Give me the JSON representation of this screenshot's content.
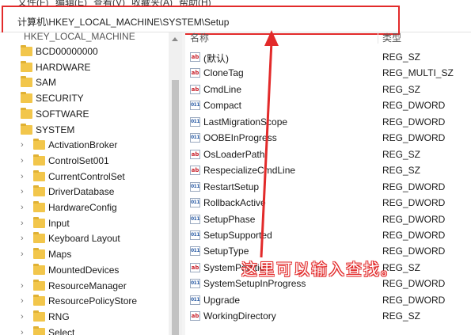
{
  "menu": {
    "items": [
      "文件(F)",
      "编辑(E)",
      "查看(V)",
      "收藏夹(A)",
      "帮助(H)"
    ]
  },
  "address": {
    "path": "计算机\\HKEY_LOCAL_MACHINE\\SYSTEM\\Setup"
  },
  "tree": {
    "root": "HKEY_LOCAL_MACHINE",
    "items": [
      {
        "label": "BCD00000000",
        "level": 1,
        "expandable": false
      },
      {
        "label": "HARDWARE",
        "level": 1,
        "expandable": false
      },
      {
        "label": "SAM",
        "level": 1,
        "expandable": false
      },
      {
        "label": "SECURITY",
        "level": 1,
        "expandable": false
      },
      {
        "label": "SOFTWARE",
        "level": 1,
        "expandable": false
      },
      {
        "label": "SYSTEM",
        "level": 1,
        "expandable": false
      },
      {
        "label": "ActivationBroker",
        "level": 2,
        "expandable": true
      },
      {
        "label": "ControlSet001",
        "level": 2,
        "expandable": true
      },
      {
        "label": "CurrentControlSet",
        "level": 2,
        "expandable": true
      },
      {
        "label": "DriverDatabase",
        "level": 2,
        "expandable": true
      },
      {
        "label": "HardwareConfig",
        "level": 2,
        "expandable": true
      },
      {
        "label": "Input",
        "level": 2,
        "expandable": true
      },
      {
        "label": "Keyboard Layout",
        "level": 2,
        "expandable": true
      },
      {
        "label": "Maps",
        "level": 2,
        "expandable": true
      },
      {
        "label": "MountedDevices",
        "level": 2,
        "expandable": false
      },
      {
        "label": "ResourceManager",
        "level": 2,
        "expandable": true
      },
      {
        "label": "ResourcePolicyStore",
        "level": 2,
        "expandable": true
      },
      {
        "label": "RNG",
        "level": 2,
        "expandable": true
      },
      {
        "label": "Select",
        "level": 2,
        "expandable": true
      }
    ]
  },
  "list": {
    "headers": {
      "name": "名称",
      "type": "类型"
    },
    "values": [
      {
        "name": "(默认)",
        "type": "REG_SZ",
        "icon": "ab"
      },
      {
        "name": "CloneTag",
        "type": "REG_MULTI_SZ",
        "icon": "ab"
      },
      {
        "name": "CmdLine",
        "type": "REG_SZ",
        "icon": "ab"
      },
      {
        "name": "Compact",
        "type": "REG_DWORD",
        "icon": "bin"
      },
      {
        "name": "LastMigrationScope",
        "type": "REG_DWORD",
        "icon": "bin"
      },
      {
        "name": "OOBEInProgress",
        "type": "REG_DWORD",
        "icon": "bin"
      },
      {
        "name": "OsLoaderPath",
        "type": "REG_SZ",
        "icon": "ab"
      },
      {
        "name": "RespecializeCmdLine",
        "type": "REG_SZ",
        "icon": "ab"
      },
      {
        "name": "RestartSetup",
        "type": "REG_DWORD",
        "icon": "bin"
      },
      {
        "name": "RollbackActive",
        "type": "REG_DWORD",
        "icon": "bin"
      },
      {
        "name": "SetupPhase",
        "type": "REG_DWORD",
        "icon": "bin"
      },
      {
        "name": "SetupSupported",
        "type": "REG_DWORD",
        "icon": "bin"
      },
      {
        "name": "SetupType",
        "type": "REG_DWORD",
        "icon": "bin"
      },
      {
        "name": "SystemPartition",
        "type": "REG_SZ",
        "icon": "ab"
      },
      {
        "name": "SystemSetupInProgress",
        "type": "REG_DWORD",
        "icon": "bin"
      },
      {
        "name": "Upgrade",
        "type": "REG_DWORD",
        "icon": "bin"
      },
      {
        "name": "WorkingDirectory",
        "type": "REG_SZ",
        "icon": "ab"
      }
    ]
  },
  "annotation": {
    "text": "这里可以输入查找。",
    "color": "#e22a2a"
  }
}
